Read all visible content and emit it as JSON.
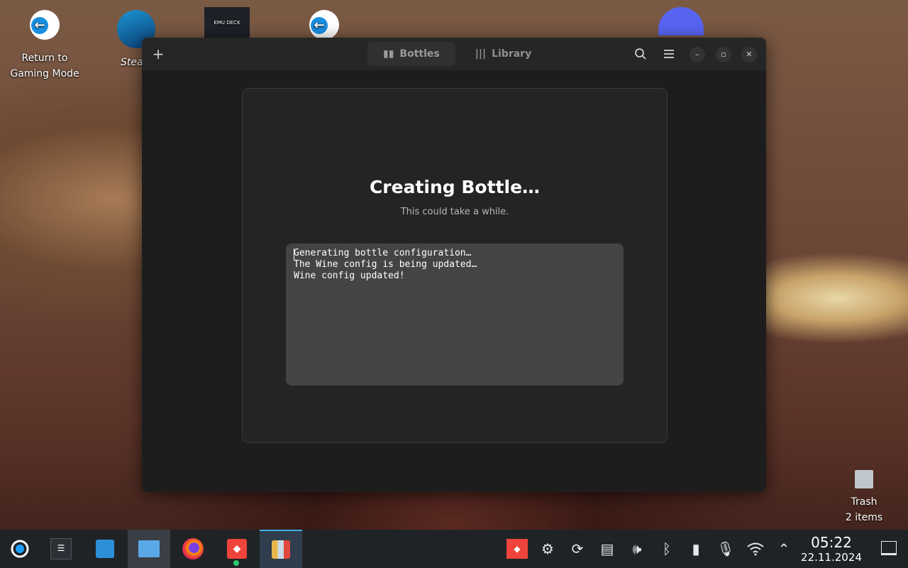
{
  "desktop": {
    "icons": [
      {
        "label": "Return to Gaming Mode"
      },
      {
        "label": "Steam"
      },
      {
        "label": "EMU DECK"
      }
    ],
    "trash": {
      "label": "Trash",
      "count": "2 items"
    }
  },
  "window": {
    "tabs": [
      {
        "label": "Bottles",
        "active": true
      },
      {
        "label": "Library",
        "active": false
      }
    ],
    "card": {
      "title": "Creating Bottle…",
      "subtitle": "This could take a while.",
      "log": [
        "Generating bottle configuration…",
        "The Wine config is being updated…",
        "Wine config updated!"
      ]
    }
  },
  "taskbar": {
    "clock": {
      "time": "05:22",
      "date": "22.11.2024"
    }
  },
  "colors": {
    "accent": "#3daee9",
    "window_bg": "#1d1d1d",
    "card_bg": "#242424",
    "log_bg": "#444444"
  }
}
